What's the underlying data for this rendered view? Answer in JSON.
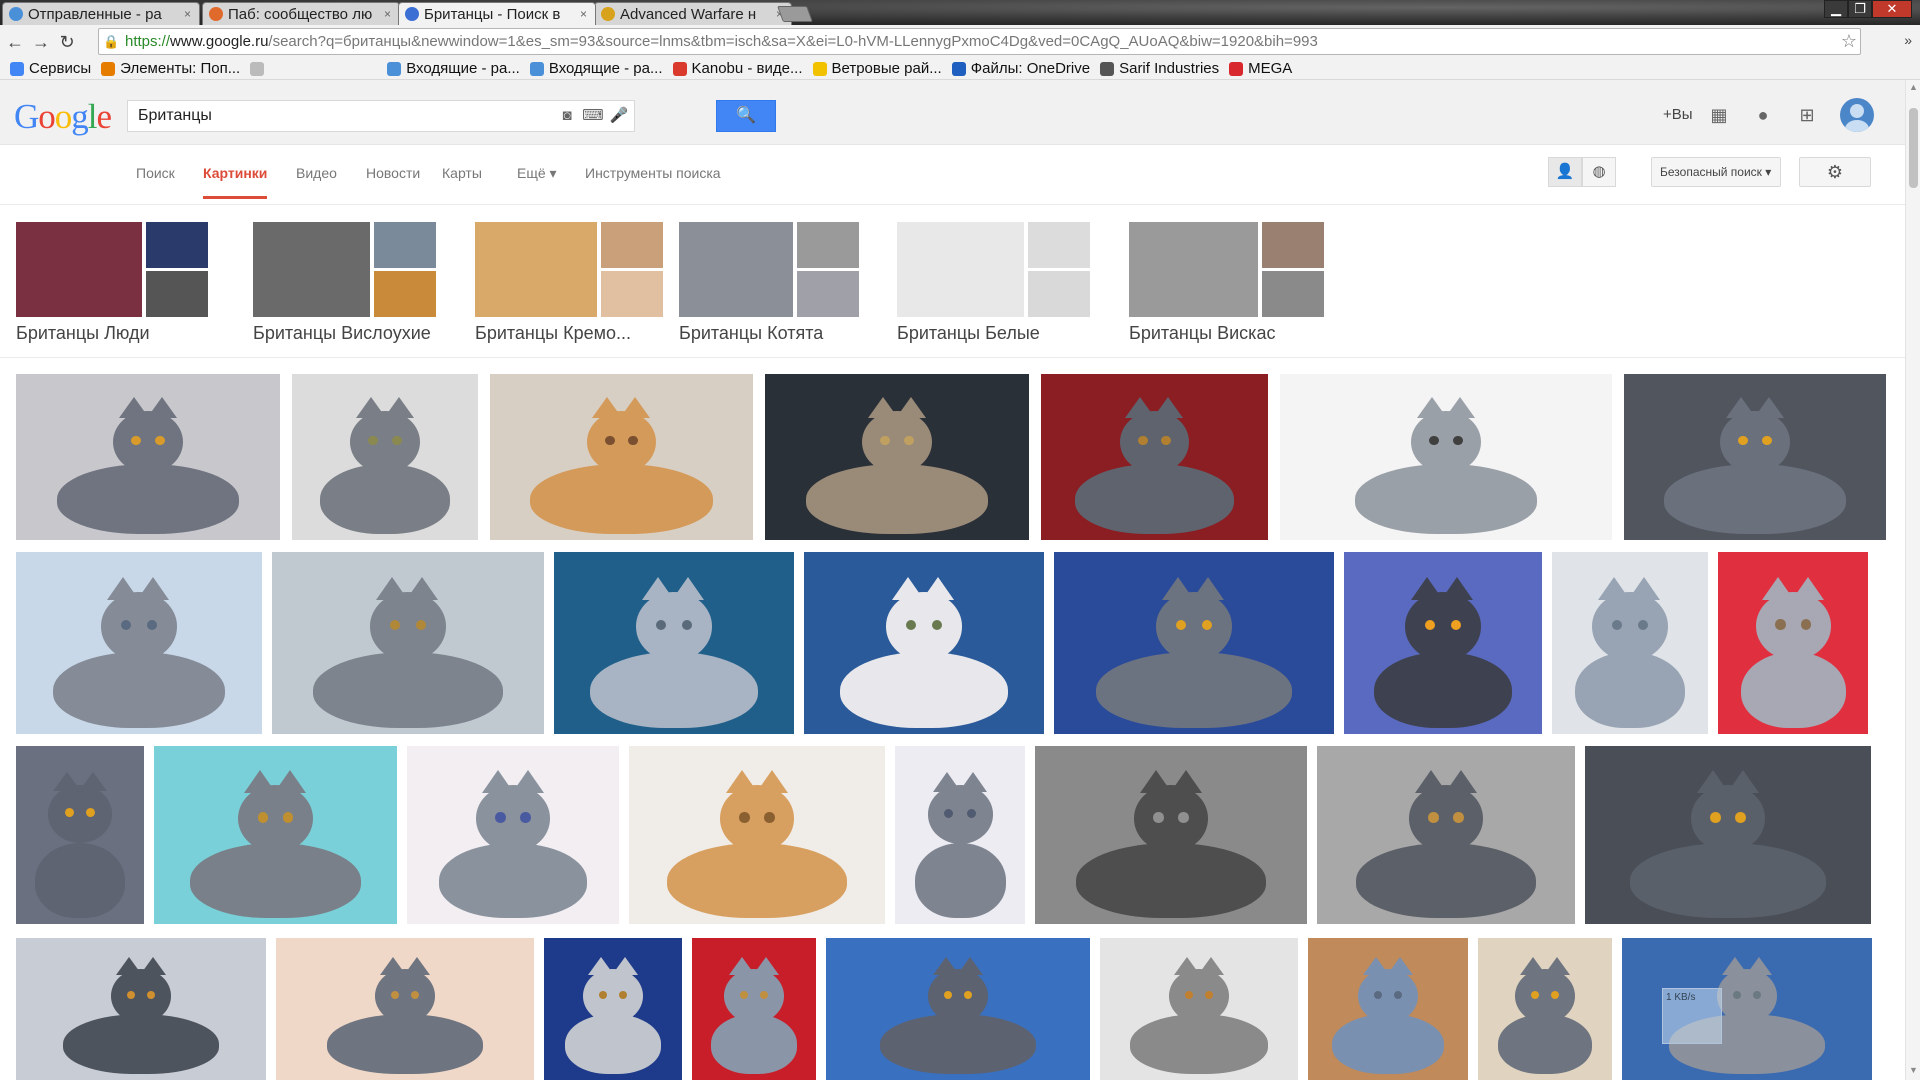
{
  "browser": {
    "tabs": [
      {
        "title": "Отправленные - ра",
        "color": "#4a90d9"
      },
      {
        "title": "Паб: сообщество лю",
        "color": "#e06a2b"
      },
      {
        "title": "Британцы - Поиск в",
        "color": "#3b6fd4"
      },
      {
        "title": "Advanced Warfare н",
        "color": "#d9a21b"
      }
    ],
    "url_scheme": "https://",
    "url_host": "www.google.ru",
    "url_rest": "/search?q=британцы&newwindow=1&es_sm=93&source=lnms&tbm=isch&sa=X&ei=L0-hVM-LLennygPxmoC4Dg&ved=0CAgQ_AUoAQ&biw=1920&bih=993",
    "bookmarks": [
      {
        "label": "Сервисы",
        "color": "#4285f4"
      },
      {
        "label": "Элементы: Поп...",
        "color": "#e57c00"
      },
      {
        "label": "",
        "color": "#bbbbbb"
      },
      {
        "label": "Входящие - ра...",
        "color": "#4a90d9"
      },
      {
        "label": "Входящие - ра...",
        "color": "#4a90d9"
      },
      {
        "label": "Kanobu - виде...",
        "color": "#d93a2b"
      },
      {
        "label": "Ветровые рай...",
        "color": "#f2c200"
      },
      {
        "label": "Файлы: OneDrive",
        "color": "#1e5fbf"
      },
      {
        "label": "Sarif Industries",
        "color": "#555555"
      },
      {
        "label": "MEGA",
        "color": "#d9272e"
      }
    ]
  },
  "google": {
    "logo_letters": [
      {
        "ch": "G",
        "color": "#4285f4"
      },
      {
        "ch": "o",
        "color": "#ea4335"
      },
      {
        "ch": "o",
        "color": "#fbbc05"
      },
      {
        "ch": "g",
        "color": "#4285f4"
      },
      {
        "ch": "l",
        "color": "#34a853"
      },
      {
        "ch": "e",
        "color": "#ea4335"
      }
    ],
    "query": "Британцы",
    "plus_you": "+Вы",
    "nav_tabs": [
      {
        "label": "Поиск",
        "active": false
      },
      {
        "label": "Картинки",
        "active": true
      },
      {
        "label": "Видео",
        "active": false
      },
      {
        "label": "Новости",
        "active": false
      },
      {
        "label": "Карты",
        "active": false
      },
      {
        "label": "Ещё ▾",
        "active": false
      },
      {
        "label": "Инструменты поиска",
        "active": false
      }
    ],
    "safe_search": "Безопасный поиск ▾"
  },
  "related": [
    {
      "label": "Британцы Люди",
      "colors": [
        "#7a3040",
        "#2a3a6a",
        "#555555"
      ]
    },
    {
      "label": "Британцы Вислоухие",
      "colors": [
        "#6a6a6a",
        "#7b8a9a",
        "#c98a3a"
      ]
    },
    {
      "label": "Британцы Кремо...",
      "colors": [
        "#d9a96a",
        "#c9a07a",
        "#e0c0a0"
      ]
    },
    {
      "label": "Британцы Котята",
      "colors": [
        "#8a8f98",
        "#9a9a9a",
        "#a0a0a8"
      ]
    },
    {
      "label": "Британцы Белые",
      "colors": [
        "#e8e8e8",
        "#dcdcdc",
        "#d9d9d9"
      ]
    },
    {
      "label": "Британцы Вискас",
      "colors": [
        "#9a9a9a",
        "#9a8070",
        "#8a8a8a"
      ]
    }
  ],
  "images": [
    {
      "bg": "#c8c8cc",
      "cat": "#6f7480",
      "eyes": "#d89a2a"
    },
    {
      "bg": "#dcdcdc",
      "cat": "#7a7e86",
      "eyes": "#8a8a50"
    },
    {
      "bg": "#d8cfc4",
      "cat": "#d49a5a",
      "eyes": "#7a5030"
    },
    {
      "bg": "#2a3038",
      "cat": "#9a8a78",
      "eyes": "#c0a060"
    },
    {
      "bg": "#8a1e22",
      "cat": "#5e636e",
      "eyes": "#b08030"
    },
    {
      "bg": "#f4f4f4",
      "cat": "#9aa0a8",
      "eyes": "#404040"
    },
    {
      "bg": "#50555e",
      "cat": "#6a707c",
      "eyes": "#e0a020"
    },
    {
      "bg": "#c8d8e8",
      "cat": "#858c98",
      "eyes": "#5a6a80"
    },
    {
      "bg": "#c0c8d0",
      "cat": "#7e848e",
      "eyes": "#b08838"
    },
    {
      "bg": "#1f5f8a",
      "cat": "#a8b4c4",
      "eyes": "#5a6a7a"
    },
    {
      "bg": "#2a5a9a",
      "cat": "#e8e8ec",
      "eyes": "#6a7a50"
    },
    {
      "bg": "#2a4a9a",
      "cat": "#6c7380",
      "eyes": "#e0a020"
    },
    {
      "bg": "#5a6ac0",
      "cat": "#3e4250",
      "eyes": "#f0a020"
    },
    {
      "bg": "#e0e4e8",
      "cat": "#98a4b4",
      "eyes": "#6a7a8a"
    },
    {
      "bg": "#e03040",
      "cat": "#a8a8b4",
      "eyes": "#8a7050"
    },
    {
      "bg": "#6a7080",
      "cat": "#5e6472",
      "eyes": "#e0a020"
    },
    {
      "bg": "#7ad0d8",
      "cat": "#7a808a",
      "eyes": "#c09030"
    },
    {
      "bg": "#f2eef2",
      "cat": "#8a929e",
      "eyes": "#4a5aa0"
    },
    {
      "bg": "#f0ece8",
      "cat": "#d8a060",
      "eyes": "#8a6030"
    },
    {
      "bg": "#ececf2",
      "cat": "#7e8490",
      "eyes": "#505a70"
    },
    {
      "bg": "#8a8a8a",
      "cat": "#4e4e4e",
      "eyes": "#909090"
    },
    {
      "bg": "#a8a8a8",
      "cat": "#5c6068",
      "eyes": "#c09040"
    },
    {
      "bg": "#4a4e56",
      "cat": "#5a606a",
      "eyes": "#e0a020"
    },
    {
      "bg": "#c8ccd4",
      "cat": "#4e545e",
      "eyes": "#d09030"
    },
    {
      "bg": "#f0d8c8",
      "cat": "#6e7480",
      "eyes": "#c09040"
    },
    {
      "bg": "#1e3a8a",
      "cat": "#c0c4cc",
      "eyes": "#b08030"
    },
    {
      "bg": "#c81e2a",
      "cat": "#8a96a8",
      "eyes": "#c09040"
    },
    {
      "bg": "#3a70c0",
      "cat": "#5c6270",
      "eyes": "#e0a020"
    },
    {
      "bg": "#e4e4e4",
      "cat": "#8a8a8a",
      "eyes": "#c08030"
    },
    {
      "bg": "#c08a5a",
      "cat": "#7a90b0",
      "eyes": "#5a6a80"
    },
    {
      "bg": "#e0d4c0",
      "cat": "#6e7480",
      "eyes": "#e0a020"
    },
    {
      "bg": "#3a6ab0",
      "cat": "#8a909c",
      "eyes": "#6a7a80"
    }
  ],
  "network_widget": "1 KB/s"
}
